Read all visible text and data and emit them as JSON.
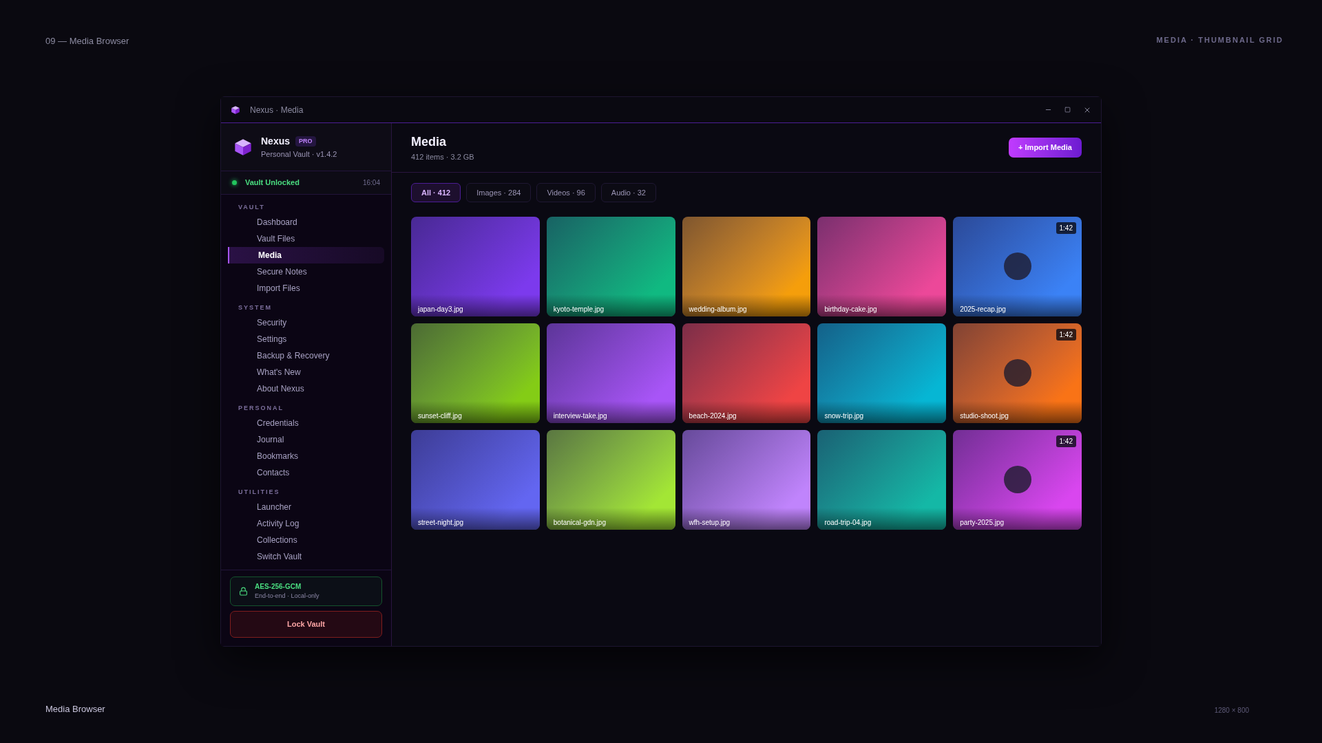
{
  "page": {
    "caption": "09 — Media Browser",
    "tag": "MEDIA · THUMBNAIL GRID",
    "footer_title": "Media Browser",
    "size": "1280 × 800"
  },
  "window": {
    "title": "Nexus · Media"
  },
  "sidebar": {
    "brand": {
      "name": "Nexus",
      "badge": "PRO",
      "subtitle": "Personal Vault · v1.4.2"
    },
    "status": {
      "label": "Vault Unlocked",
      "unlocked": true,
      "time": "16:04"
    },
    "sections": [
      {
        "title": "VAULT",
        "items": [
          {
            "label": "Dashboard",
            "selected": false
          },
          {
            "label": "Vault Files",
            "selected": false
          },
          {
            "label": "Media",
            "selected": true
          },
          {
            "label": "Secure Notes",
            "selected": false
          },
          {
            "label": "Import Files",
            "selected": false
          }
        ]
      },
      {
        "title": "SYSTEM",
        "items": [
          {
            "label": "Security",
            "selected": false
          },
          {
            "label": "Settings",
            "selected": false
          },
          {
            "label": "Backup & Recovery",
            "selected": false
          },
          {
            "label": "What's New",
            "selected": false
          },
          {
            "label": "About Nexus",
            "selected": false
          }
        ]
      },
      {
        "title": "PERSONAL",
        "items": [
          {
            "label": "Credentials",
            "selected": false
          },
          {
            "label": "Journal",
            "selected": false
          },
          {
            "label": "Bookmarks",
            "selected": false
          },
          {
            "label": "Contacts",
            "selected": false
          }
        ]
      },
      {
        "title": "UTILITIES",
        "items": [
          {
            "label": "Launcher",
            "selected": false
          },
          {
            "label": "Activity Log",
            "selected": false
          },
          {
            "label": "Collections",
            "selected": false
          },
          {
            "label": "Switch Vault",
            "selected": false
          }
        ]
      }
    ],
    "security": {
      "title": "AES-256-GCM",
      "subtitle": "End-to-end · Local-only"
    },
    "lock_button": "Lock Vault"
  },
  "main": {
    "title": "Media",
    "subtitle": "412 items · 3.2 GB",
    "import_button": "+ Import Media",
    "filters": [
      {
        "label": "All · 412",
        "selected": true
      },
      {
        "label": "Images · 284",
        "selected": false
      },
      {
        "label": "Videos · 96",
        "selected": false
      },
      {
        "label": "Audio · 32",
        "selected": false
      }
    ],
    "items": [
      {
        "name": "japan-day3.jpg",
        "kind": "image",
        "color": "#7c3aed"
      },
      {
        "name": "kyoto-temple.jpg",
        "kind": "image",
        "color": "#10b981"
      },
      {
        "name": "wedding-album.jpg",
        "kind": "image",
        "color": "#f59e0b"
      },
      {
        "name": "birthday-cake.jpg",
        "kind": "image",
        "color": "#ec4899"
      },
      {
        "name": "2025-recap.jpg",
        "kind": "video",
        "color": "#3b82f6",
        "duration": "1:42"
      },
      {
        "name": "sunset-cliff.jpg",
        "kind": "image",
        "color": "#84cc16"
      },
      {
        "name": "interview-take.jpg",
        "kind": "image",
        "color": "#a855f7"
      },
      {
        "name": "beach-2024.jpg",
        "kind": "image",
        "color": "#ef4444"
      },
      {
        "name": "snow-trip.jpg",
        "kind": "image",
        "color": "#06b6d4"
      },
      {
        "name": "studio-shoot.jpg",
        "kind": "video",
        "color": "#f97316",
        "duration": "1:42"
      },
      {
        "name": "street-night.jpg",
        "kind": "image",
        "color": "#6366f1"
      },
      {
        "name": "botanical-gdn.jpg",
        "kind": "image",
        "color": "#a3e635"
      },
      {
        "name": "wfh-setup.jpg",
        "kind": "image",
        "color": "#c084fc"
      },
      {
        "name": "road-trip-04.jpg",
        "kind": "image",
        "color": "#14b8a6"
      },
      {
        "name": "party-2025.jpg",
        "kind": "video",
        "color": "#d946ef",
        "duration": "1:42"
      }
    ]
  }
}
